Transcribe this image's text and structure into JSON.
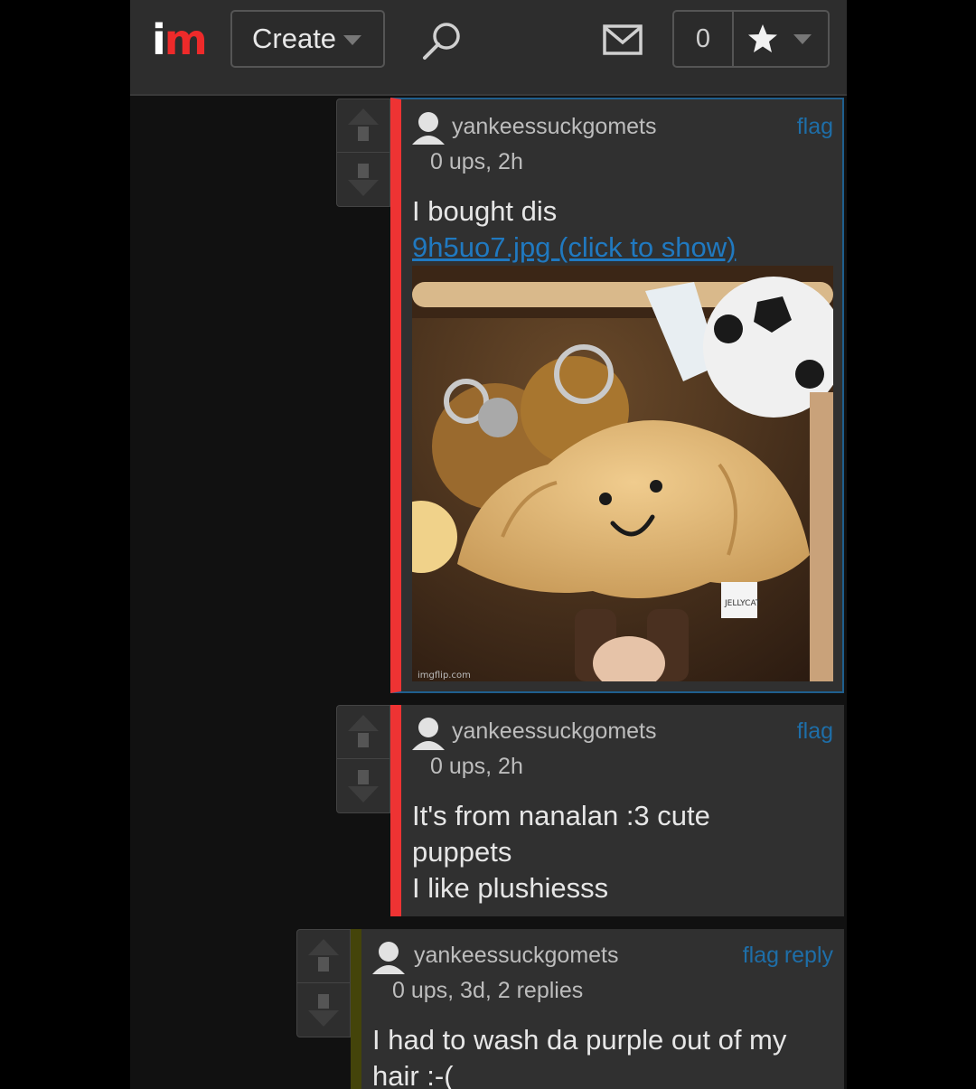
{
  "header": {
    "logo_i": "i",
    "logo_m": "m",
    "create_label": "Create",
    "notification_count": "0",
    "icons": [
      "search-icon",
      "mail-icon",
      "star-icon",
      "chevron-down-icon"
    ]
  },
  "colors": {
    "accent_red": "#ee3333",
    "link_blue": "#2079c0",
    "olive_bar": "#44440a"
  },
  "comments": [
    {
      "username": "yankeessuckgomets",
      "meta": "0 ups, 2h",
      "flag": "flag",
      "text": "I bought dis",
      "link": "9h5uo7.jpg (click to show)",
      "watermark": "imgflip.com",
      "tag_text": "JELLYCAT"
    },
    {
      "username": "yankeessuckgomets",
      "meta": "0 ups, 2h",
      "flag": "flag",
      "line1": "It's from nanalan :3 cute",
      "line2": "puppets",
      "line3": "I like plushiesss"
    },
    {
      "username": "yankeessuckgomets",
      "meta": "0 ups, 3d, 2 replies",
      "flag": "flag",
      "reply": "reply",
      "line1": "I had to wash da purple out of my",
      "line2": "hair :-("
    }
  ]
}
